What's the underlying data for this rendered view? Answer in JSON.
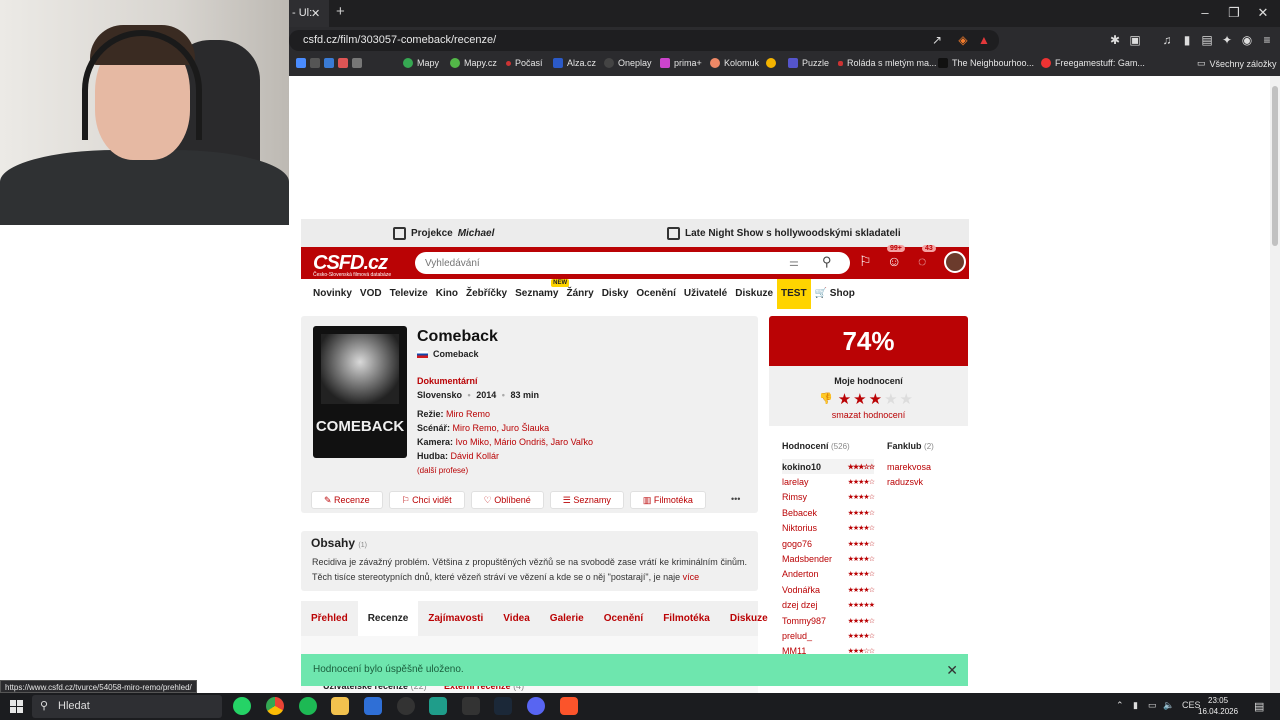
{
  "browser": {
    "tab_title": "- Ul:",
    "tab_close": "✕",
    "new_tab": "+",
    "url": "csfd.cz/film/303057-comeback/recenze/",
    "status_url": "https://www.csfd.cz/tvurce/54058-miro-remo/prehled/",
    "bookmarks": [
      "Mapy",
      "Mapy.cz",
      "Počasí",
      "Alza.cz",
      "Oneplay",
      "prima+",
      "Kolomuk",
      "Puzzle",
      "Roláda s mletým ma...",
      "The Neighbourhoo...",
      "Freegamestuff: Gam..."
    ],
    "all_bookmarks": "Všechny záložky"
  },
  "site": {
    "promo1_prefix": "Projekce ",
    "promo1_italic": "Michael",
    "promo2": "Late Night Show s hollywoodskými skladateli",
    "logo": "CSFD.cz",
    "logo_sub": "Česko-Slovenská filmová databáze",
    "search_placeholder": "Vyhledávání",
    "badge_friends": "99+",
    "badge_msgs": "43",
    "nav": [
      "Novinky",
      "VOD",
      "Televize",
      "Kino",
      "Žebříčky",
      "Seznamy",
      "Žánry",
      "Disky",
      "Ocenění",
      "Uživatelé",
      "Diskuze",
      "TEST",
      "🛒 Shop"
    ],
    "nav_new": "NEW"
  },
  "film": {
    "poster_title": "COMEBACK",
    "title": "Comeback",
    "orig_title": "Comeback",
    "genre": "Dokumentární",
    "country": "Slovensko",
    "year": "2014",
    "length": "83 min",
    "sep": "•",
    "director_label": "Režie:",
    "director": "Miro Remo",
    "writers_label": "Scénář:",
    "writers": "Miro Remo, Juro Šlauka",
    "camera_label": "Kamera:",
    "camera": "Ivo Miko, Mário Ondriš, Jaro Vaľko",
    "music_label": "Hudba:",
    "music": "Dávid Kollár",
    "more_professions": "(další profese)",
    "actions": [
      "Recenze",
      "Chci vidět",
      "Oblíbené",
      "Seznamy",
      "Filmotéka"
    ],
    "more_dots": "•••"
  },
  "obsahy": {
    "title": "Obsahy",
    "count": "(1)",
    "text": "Recidiva je závažný problém. Většina z propuštěných vězňů se na svobodě zase vrátí ke kriminálním činům. Těch tisíce stereotypních dnů, které vězeň stráví ve vězení a kde se o něj \"postarají\", je naje",
    "more": "více"
  },
  "tabs": [
    "Přehled",
    "Recenze",
    "Zajímavosti",
    "Videa",
    "Galerie",
    "Ocenění",
    "Filmotéka",
    "Diskuze"
  ],
  "reviews": {
    "user_reviews": "Uživatelské recenze",
    "user_reviews_count": "(22)",
    "external_reviews": "Externí recenze",
    "external_reviews_count": "(4)"
  },
  "rating": {
    "percent": "74%",
    "my_rating_label": "Moje hodnocení",
    "my_stars": 3,
    "delete": "smazat hodnocení",
    "ratings_label": "Hodnocení",
    "ratings_count": "(526)",
    "fanclub_label": "Fanklub",
    "fanclub_count": "(2)",
    "users": [
      {
        "name": "kokino10",
        "stars": 3
      },
      {
        "name": "larelay",
        "stars": 4
      },
      {
        "name": "Rimsy",
        "stars": 4
      },
      {
        "name": "Bebacek",
        "stars": 4
      },
      {
        "name": "Niktorius",
        "stars": 4
      },
      {
        "name": "gogo76",
        "stars": 4
      },
      {
        "name": "Madsbender",
        "stars": 4
      },
      {
        "name": "Anderton",
        "stars": 4
      },
      {
        "name": "Vodnářka",
        "stars": 4
      },
      {
        "name": "dzej dzej",
        "stars": 5
      },
      {
        "name": "Tommy987",
        "stars": 4
      },
      {
        "name": "prelud_",
        "stars": 4
      },
      {
        "name": "MM11",
        "stars": 3
      }
    ],
    "fans": [
      "marekvosa",
      "raduzsvk"
    ]
  },
  "toast": {
    "message": "Hodnocení bylo úspěšně uloženo.",
    "close": "✕"
  },
  "taskbar": {
    "search": "Hledat",
    "lang": "CES",
    "time": "23:05",
    "date": "16.04.2026"
  }
}
